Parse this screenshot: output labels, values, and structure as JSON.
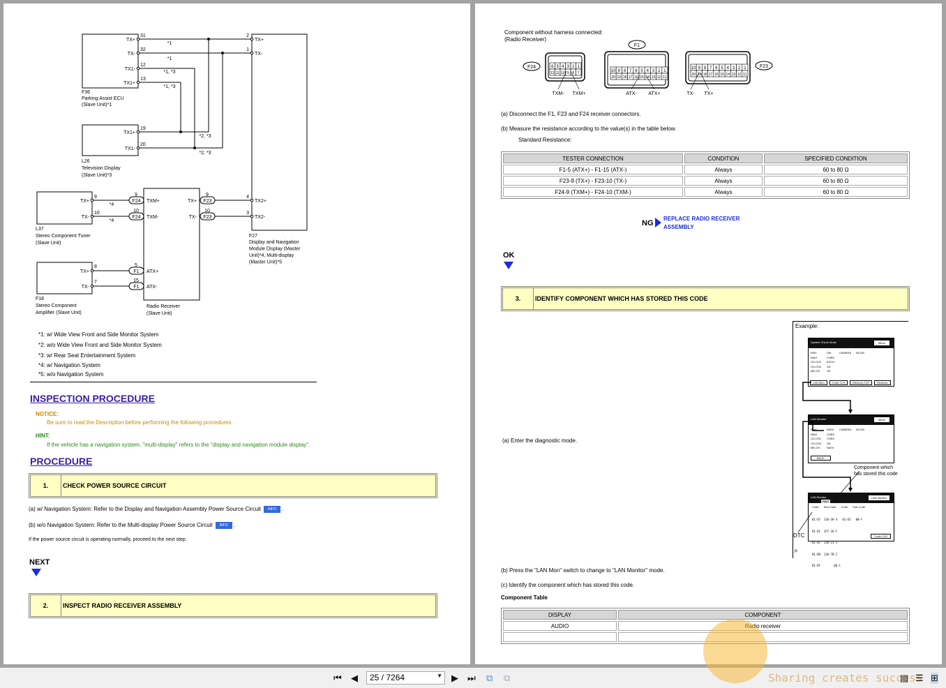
{
  "left_page": {
    "diagram": {
      "f36": {
        "code": "F36",
        "name": "Parking Assist ECU",
        "unit": "(Slave Unit)*1",
        "pins": [
          {
            "n": "31",
            "sig": "TX+"
          },
          {
            "n": "32",
            "sig": "TX-"
          },
          {
            "n": "12",
            "sig": "TX1-"
          },
          {
            "n": "13",
            "sig": "TX1+"
          }
        ]
      },
      "l26": {
        "code": "L26",
        "name": "Television Display",
        "unit": "(Slave Unit)*3",
        "pins": [
          {
            "n": "19",
            "sig": "TX1+"
          },
          {
            "n": "20",
            "sig": "TX1-"
          }
        ]
      },
      "l37": {
        "code": "L37",
        "name": "Stereo Component Tuner",
        "unit": "(Slave Unit)",
        "pins": [
          {
            "n": "9",
            "sig": "TX+"
          },
          {
            "n": "10",
            "sig": "TX-"
          }
        ]
      },
      "f18": {
        "code": "F18",
        "name": "Stereo Component",
        "unit": "Amplifier (Slave Unit)",
        "pins": [
          {
            "n": "8",
            "sig": "TX+"
          },
          {
            "n": "7",
            "sig": "TX-"
          }
        ]
      },
      "radio": {
        "name": "Radio Receiver",
        "unit": "(Slave Unit)",
        "left": [
          {
            "n": "9",
            "conn": "F24",
            "sig": "TXM+"
          },
          {
            "n": "10",
            "conn": "F24",
            "sig": "TXM-"
          },
          {
            "n": "5",
            "conn": "F1",
            "sig": "ATX+"
          },
          {
            "n": "15",
            "conn": "F1",
            "sig": "ATX-"
          }
        ],
        "right": [
          {
            "n": "9",
            "conn": "F23",
            "sig": "TX+"
          },
          {
            "n": "10",
            "conn": "F23",
            "sig": "TX-"
          }
        ]
      },
      "f27": {
        "code": "F27",
        "lines": [
          "Display and Navigation",
          "Module Display (Master",
          "Unit)*4, Multi-display",
          "(Master Unit)*5"
        ],
        "pins": [
          {
            "n": "2",
            "sig": "TX+"
          },
          {
            "n": "1",
            "sig": "TX-"
          },
          {
            "n": "4",
            "sig": "TX2+"
          },
          {
            "n": "3",
            "sig": "TX2-"
          }
        ]
      },
      "wire_notes": [
        "*1",
        "*1",
        "*1, *3",
        "*1, *3",
        "*2, *3",
        "*2, *3",
        "*4",
        "*4"
      ]
    },
    "footnotes": [
      "*1: w/ Wide View Front and Side Monitor System",
      "*2: w/o Wide View Front and Side Monitor System",
      "*3: w/ Rear Seat Entertainment System",
      "*4: w/ Navigation System",
      "*5: w/o Navigation System"
    ],
    "inspection_heading": "INSPECTION PROCEDURE",
    "notice_label": "NOTICE:",
    "notice_text": "Be sure to read the Description before performing the following procedures.",
    "hint_label": "HINT:",
    "hint_text": "If the vehicle has a navigation system, \"multi-display\" refers to the \"display and navigation module display\".",
    "procedure_heading": "PROCEDURE",
    "step1": {
      "num": "1.",
      "title": "CHECK POWER SOURCE CIRCUIT"
    },
    "step1_a": "(a) w/ Navigation System: Refer to the Display and Navigation Assembly Power Source Circuit",
    "step1_b": "(b) w/o Navigation System: Refer to the Multi-display Power Source Circuit",
    "info_label": "INFO",
    "step1_note": "If the power source circuit is operating normally, proceed to the next step.",
    "next_label": "NEXT",
    "step2": {
      "num": "2.",
      "title": "INSPECT RADIO RECEIVER ASSEMBLY"
    }
  },
  "right_page": {
    "connector_caption": [
      "Component without harness connected:",
      "(Radio Receiver)"
    ],
    "connectors": {
      "f24": {
        "code": "F24",
        "top": [
          "6",
          "5",
          "4",
          "3",
          "2",
          "1"
        ],
        "bottom": [
          "12",
          "11",
          "10",
          "9",
          "8",
          "7"
        ],
        "labels": [
          "TXM-",
          "TXM+"
        ]
      },
      "f1": {
        "code": "F1",
        "top": [
          "10",
          "9",
          "8",
          "7",
          "6",
          "5",
          "4",
          "3",
          "2",
          "1"
        ],
        "bottom": [
          "20",
          "19",
          "18",
          "17",
          "16",
          "15",
          "14",
          "13",
          "12",
          "11"
        ],
        "labels": [
          "ATX-",
          "ATX+"
        ]
      },
      "f23": {
        "code": "F23",
        "top": [
          "10",
          "9",
          "8",
          "7",
          "6",
          "5",
          "4",
          "3",
          "2",
          "1"
        ],
        "bottom": [
          "20",
          "19",
          "18",
          "17",
          "16",
          "15",
          "14",
          "13",
          "12",
          "11"
        ],
        "labels": [
          "TX-",
          "TX+"
        ]
      }
    },
    "step_a": "(a) Disconnect the F1, F23 and F24 receiver connectors.",
    "step_b": "(b) Measure the resistance according to the value(s) in the table below.",
    "standard_label": "Standard Resistance:",
    "resistance_table": {
      "headers": [
        "TESTER CONNECTION",
        "CONDITION",
        "SPECIFIED CONDITION"
      ],
      "rows": [
        [
          "F1-5 (ATX+) - F1-15 (ATX-)",
          "Always",
          "60 to 80 Ω"
        ],
        [
          "F23-9 (TX+) - F23-10 (TX-)",
          "Always",
          "60 to 80 Ω"
        ],
        [
          "F24-9 (TXM+) - F24-10 (TXM-)",
          "Always",
          "60 to 80 Ω"
        ]
      ]
    },
    "ng_label": "NG",
    "ng_link": [
      "REPLACE RADIO RECEIVER",
      "ASSEMBLY"
    ],
    "ok_label": "OK",
    "step3": {
      "num": "3.",
      "title": "IDENTIFY COMPONENT WHICH HAS STORED THIS CODE"
    },
    "example": {
      "label": "Example:",
      "screen1": {
        "title": "System Check Mode",
        "btn": "Menu",
        "rows": [
          "EMV",
          "NAVI",
          "CD-CH1",
          "CD-CH2",
          "MD-CH"
        ],
        "vals": [
          "Old",
          "CHEK",
          "EXCH",
          "OK",
          "OK"
        ],
        "camera": "CAMERA",
        "ncon": "NCON",
        "buttons": [
          "LAN Mon",
          "Code CLR",
          "Memory CLR",
          "Recheck"
        ]
      },
      "screen2": {
        "title": "LAN Monitor",
        "btn": "Menu",
        "vals": [
          "NoErr",
          "CHEK",
          "CHEK",
          "OK",
          "NoErr"
        ],
        "back": "BACK"
      },
      "screen3": {
        "title": "LAN Monitor",
        "tag": "NAVI",
        "btn": "LAN Monitor",
        "headers": [
          "Code",
          "Sub-Code",
          "Code",
          "Sub-Code"
        ],
        "rows": [
          "01-D7  110-3A-4   01-E3   00-F",
          "01-DC  1FF-3A-F",
          "01-DC  110-21-1",
          "01-DD  110-7B-2",
          "01-DF        00-1"
        ],
        "clr": "Code CLR"
      },
      "callout": [
        "Component which",
        "has stored this code"
      ],
      "dtc": "DTC",
      "p": "P"
    },
    "enter_diag": "(a) Enter the diagnostic mode.",
    "press_lan": "(b) Press the \"LAN Mon\" switch to change to \"LAN Monitor\" mode.",
    "identify": "(c) Identify the component which has stored this code.",
    "component_table": {
      "title": "Component Table",
      "headers": [
        "DISPLAY",
        "COMPONENT"
      ],
      "rows": [
        [
          "AUDIO",
          "Radio receiver"
        ]
      ]
    }
  },
  "toolbar": {
    "page_indicator": "25 / 7264",
    "watermark": "Sharing creates success"
  },
  "colors": {
    "heading": "#3a1fa0",
    "notice": "#c98a00",
    "hint": "#2a8a1a",
    "step_bg": "#ffffc4",
    "info_btn": "#3568e0",
    "nav_arrow": "#1a2be0",
    "link": "#1a2be0"
  }
}
